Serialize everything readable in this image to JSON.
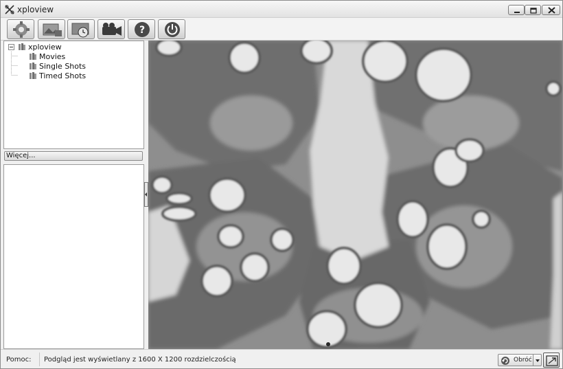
{
  "window": {
    "title": "xploview"
  },
  "toolbar": {
    "buttons": [
      {
        "icon": "settings-gear-icon"
      },
      {
        "icon": "snapshot-image-icon"
      },
      {
        "icon": "timed-shot-clock-icon"
      },
      {
        "icon": "video-camera-icon"
      },
      {
        "icon": "help-icon"
      },
      {
        "icon": "power-icon"
      }
    ]
  },
  "tree": {
    "root": "xploview",
    "children": [
      "Movies",
      "Single Shots",
      "Timed Shots"
    ]
  },
  "more_button": "Więcej...",
  "statusbar": {
    "label": "Pomoc:",
    "message": "Podgląd jest wyświetlany z 1600 X 1200 rozdzielczością",
    "rotate_label": "Obróć"
  },
  "colors": {
    "window_bg": "#f0f0f0",
    "tissue_dark": "#5e5e5e",
    "tissue_light": "#d8d8d8"
  }
}
